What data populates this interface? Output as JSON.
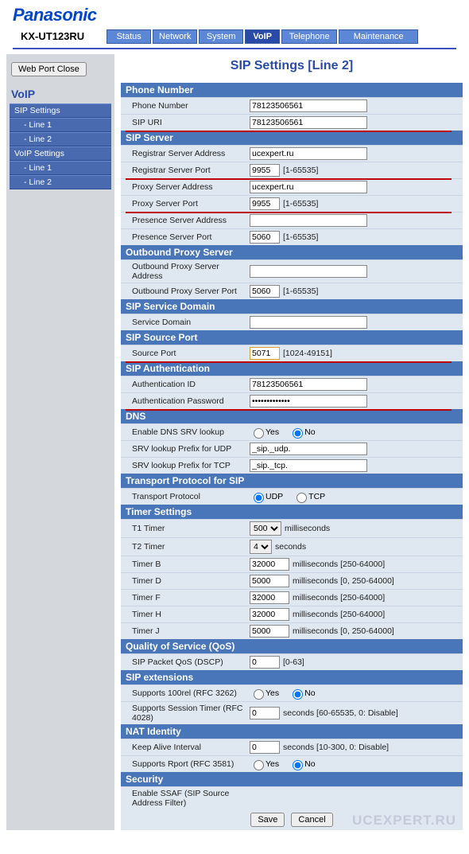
{
  "brand": "Panasonic",
  "model": "KX-UT123RU",
  "tabs": [
    "Status",
    "Network",
    "System",
    "VoIP",
    "Telephone",
    "Maintenance"
  ],
  "active_tab": "VoIP",
  "sidebar": {
    "button": "Web Port Close",
    "title": "VoIP",
    "groups": [
      {
        "label": "SIP Settings",
        "items": [
          "- Line 1",
          "- Line 2"
        ]
      },
      {
        "label": "VoIP Settings",
        "items": [
          "- Line 1",
          "- Line 2"
        ]
      }
    ]
  },
  "page_title": "SIP Settings [Line 2]",
  "sections": {
    "phone_number": {
      "head": "Phone Number",
      "phone_label": "Phone Number",
      "phone_val": "78123506561",
      "uri_label": "SIP URI",
      "uri_val": "78123506561"
    },
    "sip_server": {
      "head": "SIP Server",
      "reg_addr_l": "Registrar Server Address",
      "reg_addr_v": "ucexpert.ru",
      "reg_port_l": "Registrar Server Port",
      "reg_port_v": "9955",
      "port_hint": "[1-65535]",
      "proxy_addr_l": "Proxy Server Address",
      "proxy_addr_v": "ucexpert.ru",
      "proxy_port_l": "Proxy Server Port",
      "proxy_port_v": "9955",
      "pres_addr_l": "Presence Server Address",
      "pres_addr_v": "",
      "pres_port_l": "Presence Server Port",
      "pres_port_v": "5060"
    },
    "outbound": {
      "head": "Outbound Proxy Server",
      "addr_l": "Outbound Proxy Server Address",
      "addr_v": "",
      "port_l": "Outbound Proxy Server Port",
      "port_v": "5060",
      "port_hint": "[1-65535]"
    },
    "domain": {
      "head": "SIP Service Domain",
      "l": "Service Domain",
      "v": ""
    },
    "source": {
      "head": "SIP Source Port",
      "l": "Source Port",
      "v": "5071",
      "hint": "[1024-49151]"
    },
    "auth": {
      "head": "SIP Authentication",
      "id_l": "Authentication ID",
      "id_v": "78123506561",
      "pw_l": "Authentication Password",
      "pw_v": "•••••••••••••"
    },
    "dns": {
      "head": "DNS",
      "srv_l": "Enable DNS SRV lookup",
      "srv_sel": "No",
      "udp_l": "SRV lookup Prefix for UDP",
      "udp_v": "_sip._udp.",
      "tcp_l": "SRV lookup Prefix for TCP",
      "tcp_v": "_sip._tcp."
    },
    "transport": {
      "head": "Transport Protocol for SIP",
      "l": "Transport Protocol",
      "sel": "UDP",
      "opts": [
        "UDP",
        "TCP"
      ]
    },
    "timer": {
      "head": "Timer Settings",
      "t1_l": "T1 Timer",
      "t1_v": "500",
      "t1_u": "milliseconds",
      "t2_l": "T2 Timer",
      "t2_v": "4",
      "t2_u": "seconds",
      "tb_l": "Timer B",
      "tb_v": "32000",
      "tb_h": "milliseconds [250-64000]",
      "td_l": "Timer D",
      "td_v": "5000",
      "td_h": "milliseconds [0, 250-64000]",
      "tf_l": "Timer F",
      "tf_v": "32000",
      "tf_h": "milliseconds [250-64000]",
      "th_l": "Timer H",
      "th_v": "32000",
      "th_h": "milliseconds [250-64000]",
      "tj_l": "Timer J",
      "tj_v": "5000",
      "tj_h": "milliseconds [0, 250-64000]"
    },
    "qos": {
      "head": "Quality of Service (QoS)",
      "l": "SIP Packet QoS (DSCP)",
      "v": "0",
      "hint": "[0-63]"
    },
    "ext": {
      "head": "SIP extensions",
      "r100_l": "Supports 100rel (RFC 3262)",
      "r100_sel": "No",
      "sess_l": "Supports Session Timer (RFC 4028)",
      "sess_v": "0",
      "sess_h": "seconds [60-65535, 0: Disable]"
    },
    "nat": {
      "head": "NAT Identity",
      "ka_l": "Keep Alive Interval",
      "ka_v": "0",
      "ka_h": "seconds [10-300, 0: Disable]",
      "rp_l": "Supports Rport (RFC 3581)",
      "rp_sel": "No"
    },
    "sec": {
      "head": "Security",
      "l": "Enable SSAF (SIP Source Address Filter)"
    }
  },
  "yes": "Yes",
  "no": "No",
  "footer": {
    "save": "Save",
    "cancel": "Cancel"
  },
  "watermark": "UCEXPERT.RU"
}
